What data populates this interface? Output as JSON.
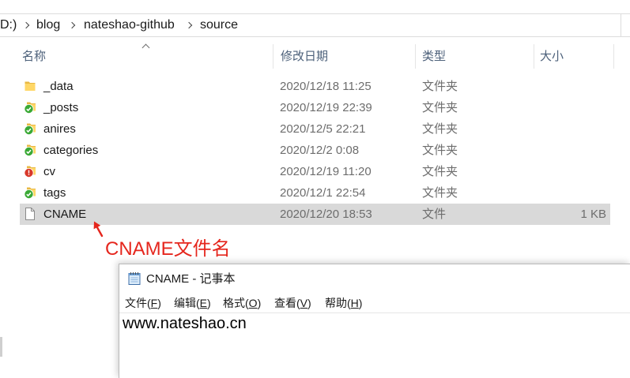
{
  "explorer": {
    "breadcrumb": [
      "D:)",
      "blog",
      "nateshao-github",
      "source"
    ],
    "columns": {
      "name": "名称",
      "modified": "修改日期",
      "type": "类型",
      "size": "大小",
      "sort_indicator": "chevron-up-icon"
    },
    "files": [
      {
        "icon": "folder-icon",
        "name": "_data",
        "modified": "2020/12/18 11:25",
        "type": "文件夹"
      },
      {
        "icon": "folder-synced-icon",
        "name": "_posts",
        "modified": "2020/12/19 22:39",
        "type": "文件夹"
      },
      {
        "icon": "folder-synced-icon",
        "name": "anires",
        "modified": "2020/12/5 22:21",
        "type": "文件夹"
      },
      {
        "icon": "folder-synced-icon",
        "name": "categories",
        "modified": "2020/12/2 0:08",
        "type": "文件夹"
      },
      {
        "icon": "folder-error-icon",
        "name": "cv",
        "modified": "2020/12/19 11:20",
        "type": "文件夹"
      },
      {
        "icon": "folder-synced-icon",
        "name": "tags",
        "modified": "2020/12/1 22:54",
        "type": "文件夹"
      },
      {
        "icon": "file-icon",
        "name": "CNAME",
        "modified": "2020/12/20 18:53",
        "type": "文件",
        "size": "1 KB",
        "selected": true
      }
    ]
  },
  "annotation": {
    "text": "CNAME文件名",
    "icon": "arrow-up-icon"
  },
  "notepad": {
    "icon": "notepad-icon",
    "title": "CNAME - 记事本",
    "menu": [
      {
        "before": "文件(",
        "key": "F",
        "after": ")"
      },
      {
        "before": "编辑(",
        "key": "E",
        "after": ")"
      },
      {
        "before": "格式(",
        "key": "O",
        "after": ")"
      },
      {
        "before": "查看(",
        "key": "V",
        "after": ")"
      },
      {
        "before": "帮助(",
        "key": "H",
        "after": ")"
      }
    ],
    "content": "www.nateshao.cn"
  },
  "colors": {
    "selection": "#d9d9d9",
    "annotation": "#e5261d",
    "synced": "#3aa935",
    "error": "#d8382a",
    "folder": "#ffd766",
    "header_text": "#4c607a"
  }
}
